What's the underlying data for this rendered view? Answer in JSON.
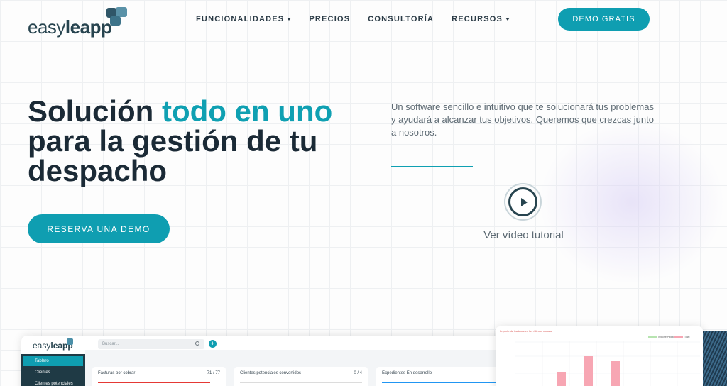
{
  "brand": {
    "name_light": "easy",
    "name_bold": "leapp"
  },
  "nav": {
    "items": [
      {
        "label": "FUNCIONALIDADES",
        "dropdown": true
      },
      {
        "label": "PRECIOS",
        "dropdown": false
      },
      {
        "label": "CONSULTORÍA",
        "dropdown": false
      },
      {
        "label": "RECURSOS",
        "dropdown": true
      }
    ],
    "cta": "DEMO GRATIS"
  },
  "hero": {
    "title_part1": "Solución ",
    "title_accent": "todo en uno",
    "title_part2": "para la gestión de tu despacho",
    "cta": "RESERVA UNA DEMO",
    "description": "Un software sencillo e intuitivo que te solucionará tus problemas y ayudará a alcanzar tus objetivos. Queremos que crezcas junto a nosotros.",
    "video_label": "Ver vídeo tutorial"
  },
  "mockup": {
    "search_placeholder": "Buscar...",
    "sidebar_items": [
      "Tablero",
      "Clientes",
      "Clientes potenciales"
    ],
    "cards": [
      {
        "label": "Facturas por cobrar",
        "value": "71 / 77",
        "color": "#e53935"
      },
      {
        "label": "Clientes potenciales convertidos",
        "value": "0 / 4",
        "color": "#cccccc"
      },
      {
        "label": "Expedientes En desarrollo",
        "value": "",
        "color": "#2196f3"
      }
    ]
  },
  "chart_card": {
    "title": "Importe de facturas en los últimos meses",
    "legend": [
      "Importe Pagado",
      "Total"
    ],
    "legend_colors": [
      "#b7e4b0",
      "#f7a6b3"
    ]
  },
  "colors": {
    "accent": "#0f9eb1",
    "dark": "#1b2a36"
  }
}
